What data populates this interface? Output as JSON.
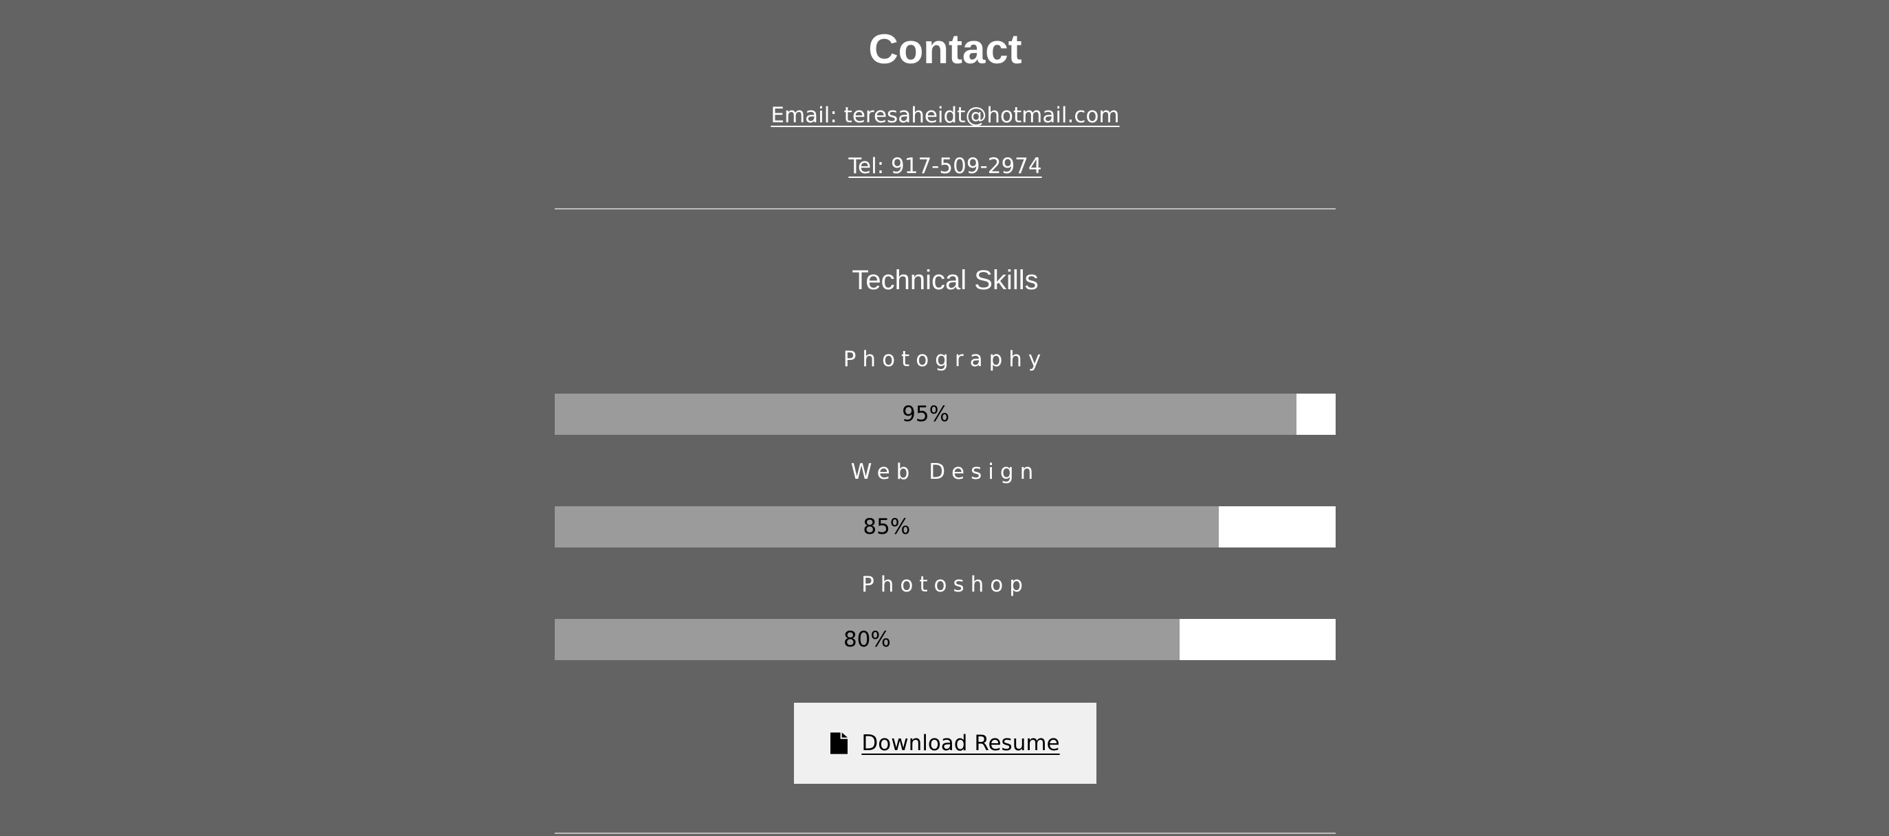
{
  "contact": {
    "title": "Contact",
    "email_text": "Email: teresaheidt@hotmail.com",
    "tel_text": "Tel: 917-509-2974"
  },
  "skills": {
    "title": "Technical Skills",
    "items": [
      {
        "label": "Photography",
        "percent": 95,
        "percent_text": "95%"
      },
      {
        "label": "Web Design",
        "percent": 85,
        "percent_text": "85%"
      },
      {
        "label": "Photoshop",
        "percent": 80,
        "percent_text": "80%"
      }
    ]
  },
  "resume": {
    "label": "Download Resume",
    "icon": "file-icon"
  },
  "colors": {
    "background": "#636363",
    "bar_fill": "#9b9b9b",
    "bar_track": "#ffffff",
    "button_bg": "#f0f0f0"
  }
}
